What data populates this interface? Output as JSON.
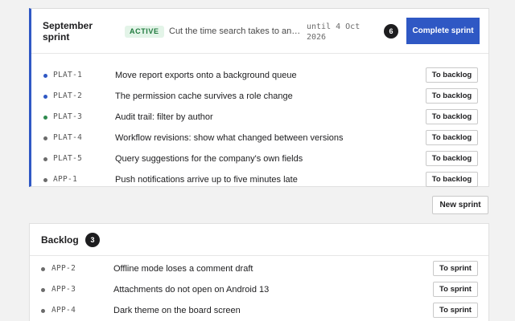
{
  "sprint": {
    "title": "September sprint",
    "status": "ACTIVE",
    "goal": "Cut the time search takes to ans…",
    "until": "until 4 Oct 2026",
    "count": "6",
    "complete_label": "Complete sprint",
    "move_label": "To backlog",
    "issues": [
      {
        "key": "PLAT-1",
        "title": "Move report exports onto a background queue",
        "dot_color": "#2f58c4"
      },
      {
        "key": "PLAT-2",
        "title": "The permission cache survives a role change",
        "dot_color": "#2f58c4"
      },
      {
        "key": "PLAT-3",
        "title": "Audit trail: filter by author",
        "dot_color": "#2e8a4e"
      },
      {
        "key": "PLAT-4",
        "title": "Workflow revisions: show what changed between versions",
        "dot_color": "#6b6b6b"
      },
      {
        "key": "PLAT-5",
        "title": "Query suggestions for the company's own fields",
        "dot_color": "#6b6b6b"
      },
      {
        "key": "APP-1",
        "title": "Push notifications arrive up to five minutes late",
        "dot_color": "#6b6b6b"
      }
    ]
  },
  "new_sprint_label": "New sprint",
  "backlog": {
    "title": "Backlog",
    "count": "3",
    "move_label": "To sprint",
    "issues": [
      {
        "key": "APP-2",
        "title": "Offline mode loses a comment draft",
        "dot_color": "#6b6b6b"
      },
      {
        "key": "APP-3",
        "title": "Attachments do not open on Android 13",
        "dot_color": "#6b6b6b"
      },
      {
        "key": "APP-4",
        "title": "Dark theme on the board screen",
        "dot_color": "#6b6b6b"
      }
    ]
  },
  "colors": {
    "accent": "#2f58c4",
    "active_badge_bg": "#e3f4e8",
    "active_badge_text": "#1f7a3d"
  }
}
